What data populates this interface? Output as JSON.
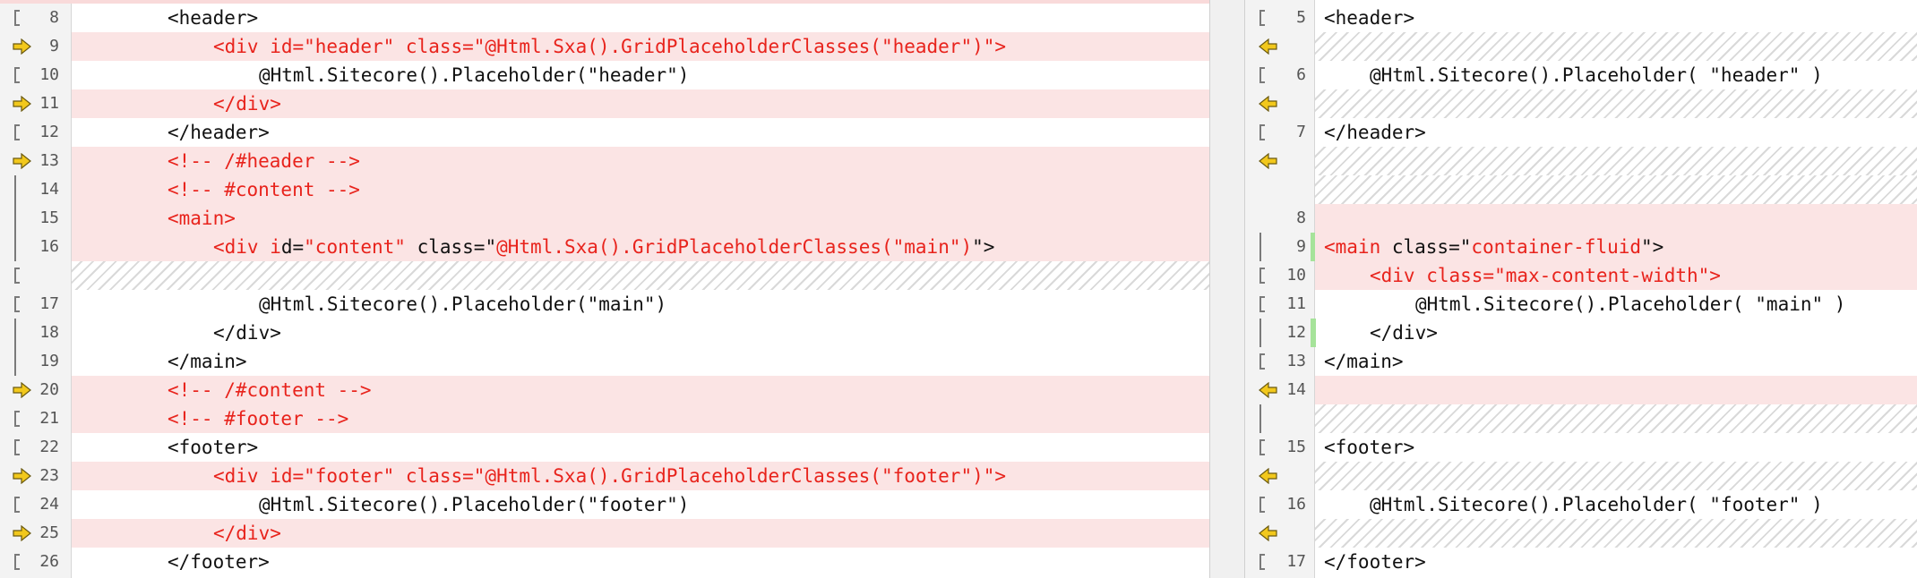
{
  "colors": {
    "changed_background": "#fbe4e4",
    "changed_text": "#e8231c",
    "added_marker": "#a6e39a",
    "arrow_fill": "#f2c81c"
  },
  "left_pane": {
    "lines": [
      {
        "num": "8",
        "marker": "bracket",
        "state": "normal",
        "indent": 1,
        "segments": [
          {
            "text": "<header>",
            "c": "black"
          }
        ]
      },
      {
        "num": "9",
        "marker": "arrow",
        "state": "changed",
        "indent": 2,
        "segments": [
          {
            "text": "<div id=\"header\" class=\"@Html.Sxa().GridPlaceholderClasses(\"header\")\">",
            "c": "red"
          }
        ]
      },
      {
        "num": "10",
        "marker": "bracket",
        "state": "normal",
        "indent": 3,
        "segments": [
          {
            "text": "@Html.Sitecore().Placeholder(\"header\")",
            "c": "black"
          }
        ]
      },
      {
        "num": "11",
        "marker": "arrow",
        "state": "changed",
        "indent": 2,
        "segments": [
          {
            "text": "</div>",
            "c": "red"
          }
        ]
      },
      {
        "num": "12",
        "marker": "bracket",
        "state": "normal",
        "indent": 1,
        "segments": [
          {
            "text": "</header>",
            "c": "black"
          }
        ]
      },
      {
        "num": "13",
        "marker": "arrow",
        "state": "changed",
        "indent": 1,
        "segments": [
          {
            "text": "<!-- /#header -->",
            "c": "red"
          }
        ]
      },
      {
        "num": "14",
        "marker": "bar",
        "state": "changed",
        "indent": 1,
        "segments": [
          {
            "text": "<!-- #content -->",
            "c": "red"
          }
        ]
      },
      {
        "num": "15",
        "marker": "bar",
        "state": "changed",
        "indent": 1,
        "segments": [
          {
            "text": "<main>",
            "c": "red"
          }
        ]
      },
      {
        "num": "16",
        "marker": "bar",
        "state": "changed",
        "indent": 2,
        "segments": [
          {
            "text": "<div i",
            "c": "red"
          },
          {
            "text": "d=",
            "c": "black"
          },
          {
            "text": "\"content\"",
            "c": "red"
          },
          {
            "text": " class=\"",
            "c": "black"
          },
          {
            "text": "@Html.Sxa().GridPlaceholderClasses(\"main\")",
            "c": "red"
          },
          {
            "text": "\">",
            "c": "black"
          }
        ]
      },
      {
        "num": "",
        "marker": "bracket-end",
        "state": "empty",
        "indent": 0,
        "segments": []
      },
      {
        "num": "17",
        "marker": "bracket",
        "state": "normal",
        "indent": 3,
        "segments": [
          {
            "text": "@Html.Sitecore().Placeholder(\"main\")",
            "c": "black"
          }
        ]
      },
      {
        "num": "18",
        "marker": "bar",
        "state": "normal",
        "indent": 2,
        "segments": [
          {
            "text": "</div>",
            "c": "black"
          }
        ]
      },
      {
        "num": "19",
        "marker": "bar",
        "state": "normal",
        "indent": 1,
        "segments": [
          {
            "text": "</main>",
            "c": "black"
          }
        ]
      },
      {
        "num": "20",
        "marker": "arrow",
        "state": "changed",
        "indent": 1,
        "segments": [
          {
            "text": "<!-- /#content -->",
            "c": "red"
          }
        ]
      },
      {
        "num": "21",
        "marker": "bracket",
        "state": "changed",
        "indent": 1,
        "segments": [
          {
            "text": "<!-- #footer -->",
            "c": "red"
          }
        ]
      },
      {
        "num": "22",
        "marker": "bracket",
        "state": "normal",
        "indent": 1,
        "segments": [
          {
            "text": "<footer>",
            "c": "black"
          }
        ]
      },
      {
        "num": "23",
        "marker": "arrow",
        "state": "changed",
        "indent": 2,
        "segments": [
          {
            "text": "<div id=\"footer\" class=\"@Html.Sxa().GridPlaceholderClasses(\"footer\")\">",
            "c": "red"
          }
        ]
      },
      {
        "num": "24",
        "marker": "bracket",
        "state": "normal",
        "indent": 3,
        "segments": [
          {
            "text": "@Html.Sitecore().Placeholder(\"footer\")",
            "c": "black"
          }
        ]
      },
      {
        "num": "25",
        "marker": "arrow",
        "state": "changed",
        "indent": 2,
        "segments": [
          {
            "text": "</div>",
            "c": "red"
          }
        ]
      },
      {
        "num": "26",
        "marker": "bracket",
        "state": "normal",
        "indent": 1,
        "segments": [
          {
            "text": "</footer>",
            "c": "black"
          }
        ]
      }
    ]
  },
  "right_pane": {
    "lines": [
      {
        "num": "5",
        "marker": "bracket",
        "state": "normal",
        "indent": 0,
        "segments": [
          {
            "text": "<header>",
            "c": "black"
          }
        ]
      },
      {
        "num": "",
        "marker": "arrow",
        "state": "empty",
        "indent": 0,
        "segments": []
      },
      {
        "num": "6",
        "marker": "bracket",
        "state": "normal",
        "indent": 1,
        "segments": [
          {
            "text": "@Html.Sitecore().Placeholder( \"header\" )",
            "c": "black"
          }
        ]
      },
      {
        "num": "",
        "marker": "arrow",
        "state": "empty",
        "indent": 0,
        "segments": []
      },
      {
        "num": "7",
        "marker": "bracket",
        "state": "normal",
        "indent": 0,
        "segments": [
          {
            "text": "</header>",
            "c": "black"
          }
        ]
      },
      {
        "num": "",
        "marker": "arrow",
        "state": "empty",
        "indent": 0,
        "segments": []
      },
      {
        "num": "",
        "marker": "none",
        "state": "empty",
        "indent": 0,
        "segments": []
      },
      {
        "num": "8",
        "marker": "none",
        "state": "changed",
        "indent": 0,
        "segments": []
      },
      {
        "num": "9",
        "marker": "bar",
        "state": "changed",
        "green": true,
        "indent": 0,
        "segments": [
          {
            "text": "<main",
            "c": "red"
          },
          {
            "text": " class=\"",
            "c": "black"
          },
          {
            "text": "container-fluid",
            "c": "red"
          },
          {
            "text": "\">",
            "c": "black"
          }
        ]
      },
      {
        "num": "10",
        "marker": "bracket-end",
        "state": "changed",
        "indent": 1,
        "segments": [
          {
            "text": "<div class=\"max-content-width\">",
            "c": "red"
          }
        ]
      },
      {
        "num": "11",
        "marker": "bracket",
        "state": "normal",
        "indent": 2,
        "segments": [
          {
            "text": "@Html.Sitecore().Placeholder( \"main\" )",
            "c": "black"
          }
        ]
      },
      {
        "num": "12",
        "marker": "bar",
        "state": "normal",
        "green": true,
        "indent": 1,
        "segments": [
          {
            "text": "</div>",
            "c": "black"
          }
        ]
      },
      {
        "num": "13",
        "marker": "bracket-end",
        "state": "normal",
        "indent": 0,
        "segments": [
          {
            "text": "</main>",
            "c": "black"
          }
        ]
      },
      {
        "num": "14",
        "marker": "arrow",
        "state": "changed",
        "indent": 0,
        "segments": []
      },
      {
        "num": "",
        "marker": "bar",
        "state": "empty",
        "indent": 0,
        "segments": []
      },
      {
        "num": "15",
        "marker": "bracket",
        "state": "normal",
        "indent": 0,
        "segments": [
          {
            "text": "<footer>",
            "c": "black"
          }
        ]
      },
      {
        "num": "",
        "marker": "arrow",
        "state": "empty",
        "indent": 0,
        "segments": []
      },
      {
        "num": "16",
        "marker": "bracket",
        "state": "normal",
        "indent": 1,
        "segments": [
          {
            "text": "@Html.Sitecore().Placeholder( \"footer\" )",
            "c": "black"
          }
        ]
      },
      {
        "num": "",
        "marker": "arrow",
        "state": "empty",
        "indent": 0,
        "segments": []
      },
      {
        "num": "17",
        "marker": "bracket",
        "state": "normal",
        "indent": 0,
        "segments": [
          {
            "text": "</footer>",
            "c": "black"
          }
        ]
      }
    ]
  }
}
